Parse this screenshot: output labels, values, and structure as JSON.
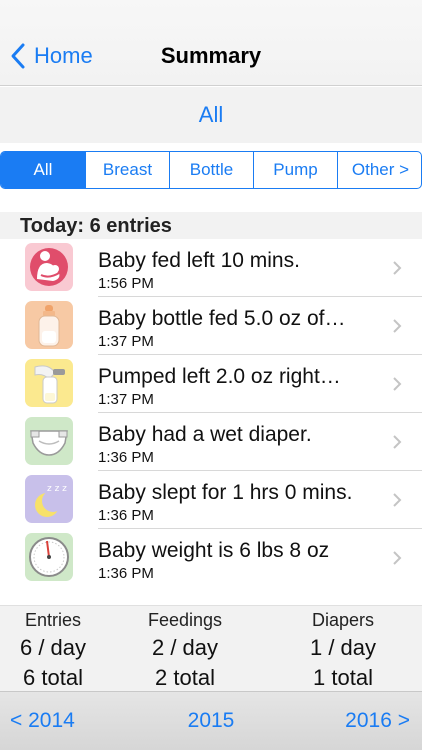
{
  "nav": {
    "back_label": "Home",
    "title": "Summary"
  },
  "filter": {
    "current_label": "All"
  },
  "segments": [
    "All",
    "Breast",
    "Bottle",
    "Pump",
    "Other >"
  ],
  "section": {
    "header": "Today: 6 entries"
  },
  "entries": [
    {
      "icon": "breastfeeding-icon",
      "title": "Baby fed left 10 mins.",
      "time": "1:56 PM"
    },
    {
      "icon": "bottle-icon",
      "title": "Baby bottle fed 5.0 oz of…",
      "time": "1:37 PM"
    },
    {
      "icon": "breast-pump-icon",
      "title": "Pumped left 2.0 oz right…",
      "time": "1:37 PM"
    },
    {
      "icon": "diaper-icon",
      "title": "Baby had a wet diaper.",
      "time": "1:36 PM"
    },
    {
      "icon": "sleep-moon-icon",
      "title": "Baby slept for 1 hrs 0 mins.",
      "time": "1:36 PM"
    },
    {
      "icon": "weight-scale-icon",
      "title": "Baby weight is 6 lbs 8 oz",
      "time": "1:36 PM"
    }
  ],
  "stats": {
    "entries": {
      "label": "Entries",
      "per_day": "6 / day",
      "total": "6 total"
    },
    "feedings": {
      "label": "Feedings",
      "per_day": "2 / day",
      "total": "2 total"
    },
    "diapers": {
      "label": "Diapers",
      "per_day": "1 / day",
      "total": "1 total"
    }
  },
  "years": {
    "prev": "< 2014",
    "current": "2015",
    "next": "2016 >"
  },
  "colors": {
    "accent": "#1a7cf3"
  }
}
